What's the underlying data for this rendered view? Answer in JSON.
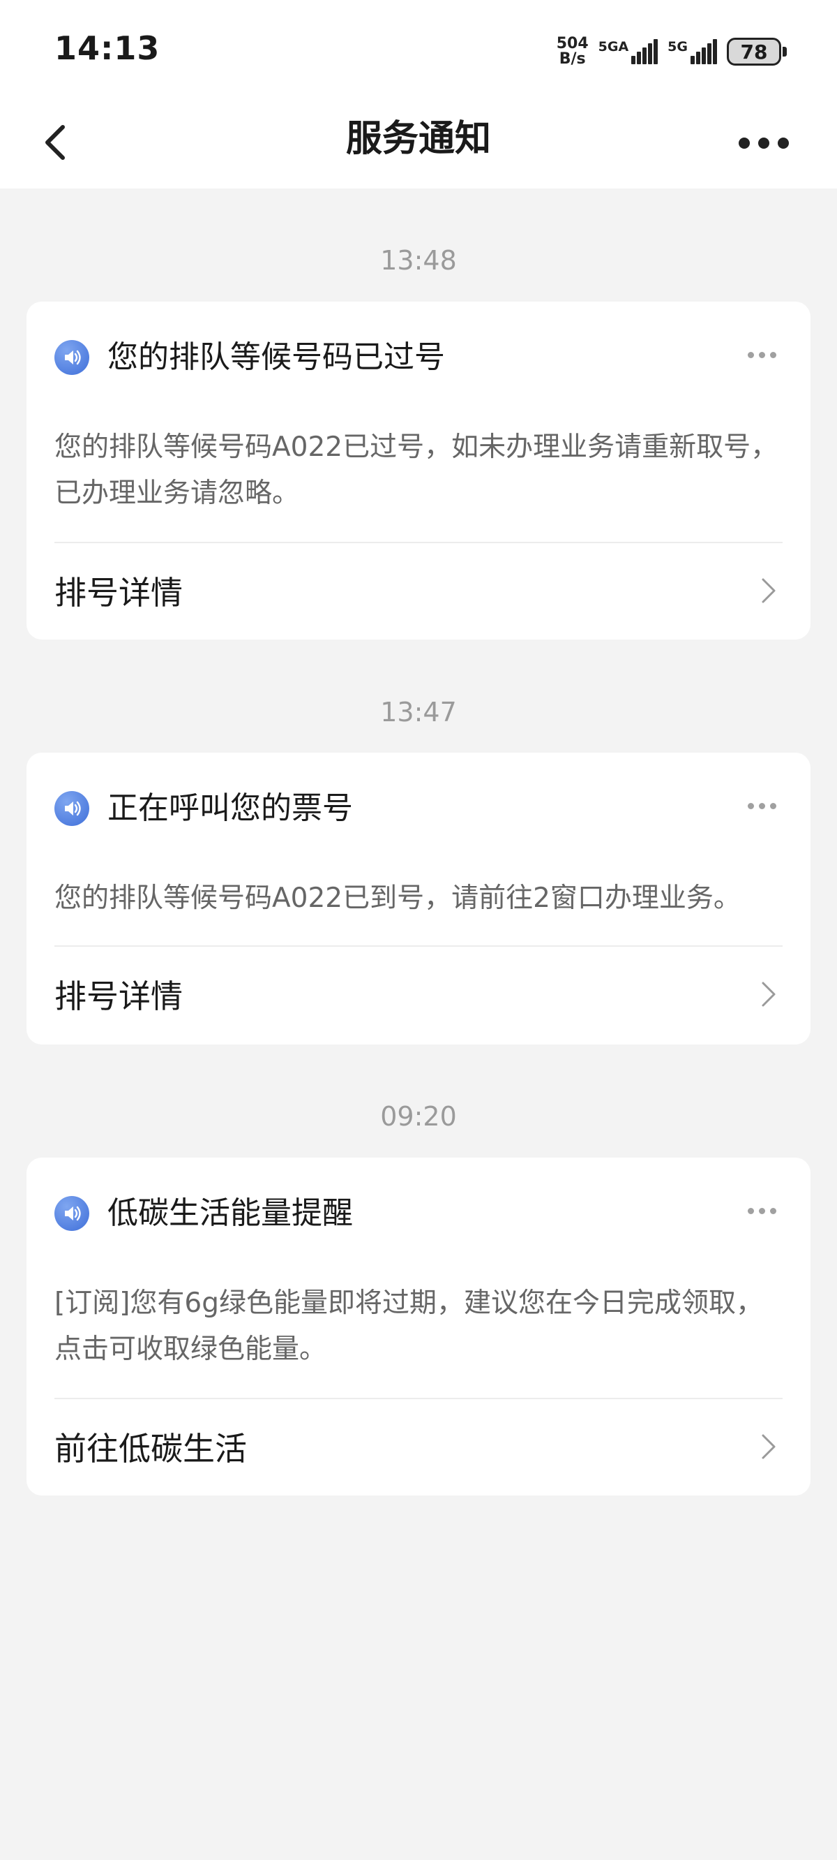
{
  "status_bar": {
    "time": "14:13",
    "net_speed_value": "504",
    "net_speed_unit": "B/s",
    "signal1_label": "5GA",
    "signal2_label": "5G",
    "battery": "78"
  },
  "nav": {
    "title": "服务通知"
  },
  "messages": [
    {
      "time": "13:48",
      "title": "您的排队等候号码已过号",
      "body": "您的排队等候号码A022已过号，如未办理业务请重新取号，已办理业务请忽略。",
      "link": "排号详情"
    },
    {
      "time": "13:47",
      "title": "正在呼叫您的票号",
      "body": "您的排队等候号码A022已到号，请前往2窗口办理业务。",
      "link": "排号详情"
    },
    {
      "time": "09:20",
      "title": "低碳生活能量提醒",
      "body": "[订阅]您有6g绿色能量即将过期，建议您在今日完成领取，点击可收取绿色能量。",
      "link": "前往低碳生活"
    }
  ],
  "icons": {
    "back": "back-arrow-icon",
    "more": "more-icon",
    "speaker": "speaker-icon",
    "chevron": "chevron-right-icon"
  },
  "colors": {
    "background": "#f3f3f3",
    "card": "#ffffff",
    "speaker_icon": "#3f6fd9",
    "timestamp": "#9a9a9a",
    "body_text": "#666666"
  }
}
